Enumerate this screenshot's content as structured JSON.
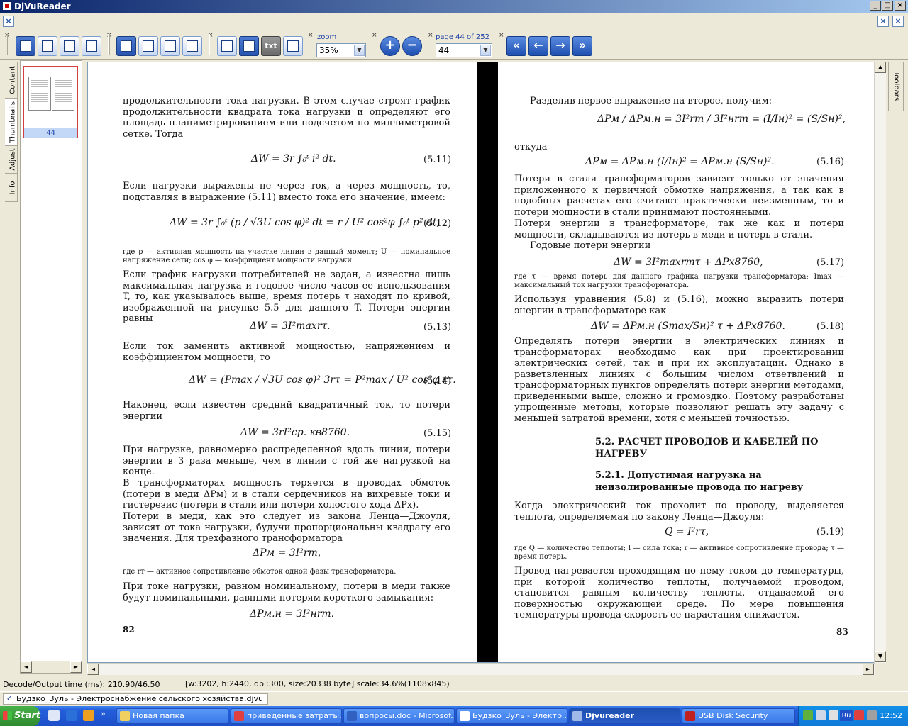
{
  "app": {
    "title": "DjVuReader"
  },
  "toolbar": {
    "zoom_label": "zoom",
    "zoom_value": "35%",
    "page_label": "page 44 of 252",
    "page_value": "44",
    "txt_label": "txt"
  },
  "sidebar": {
    "tabs": [
      {
        "label": "Content"
      },
      {
        "label": "Thumbnails"
      },
      {
        "label": "Adjust"
      },
      {
        "label": "Info"
      }
    ],
    "thumbnail_label": "44"
  },
  "right_tab": {
    "label": "Toolbars"
  },
  "document": {
    "left": {
      "p1": "продолжительности тока нагрузки. В этом случае строят график продолжительности квадрата тока нагрузки и определяют его площадь планиметрированием или подсчетом по миллиметровой сетке. Тогда",
      "f511": "ΔW = 3r ∫₀ᵗ i² dt.",
      "e511": "(5.11)",
      "p2": "Если нагрузки выражены не через ток, а через мощность, то, подставляя в выражение (5.11) вместо тока его значение, имеем:",
      "f512": "ΔW = 3r ∫₀ᵗ (p / √3U cos φ)² dt = r / U² cos²φ ∫₀ᵗ p² dt,",
      "e512": "(5.12)",
      "n512": "где p — активная мощность на участке линии в данный момент; U — номинальное напряжение сети; cos φ — коэффициент мощности нагрузки.",
      "p3": "Если график нагрузки потребителей не задан, а известна лишь максимальная нагрузка и годовое число часов ее использования T, то, как указывалось выше, время потерь τ находят по кривой, изображенной на рисунке 5.5 для данного T. Потери энергии равны",
      "f513": "ΔW = 3I²maxrτ.",
      "e513": "(5.13)",
      "p4": "Если ток заменить активной мощностью, напряжением и коэффициентом мощности, то",
      "f514": "ΔW = (Pmax / √3U cos φ)² 3rτ = P²max / U² cos²φ rτ.",
      "e514": "(5.14)",
      "p5": "Наконец, если известен средний квадратичный ток, то потери энергии",
      "f515": "ΔW = 3rI²ср. кв8760.",
      "e515": "(5.15)",
      "p6": "При нагрузке, равномерно распределенной вдоль линии, потери энергии в 3 раза меньше, чем в линии с той же нагрузкой на конце.",
      "p7": "В трансформаторах мощность теряется в проводах обмоток (потери в меди ΔPм) и в стали сердечников на вихревые токи и гистерезис (потери в стали или потери холостого хода ΔPx).",
      "p8": "Потери в меди, как это следует из закона Ленца—Джоуля, зависят от тока нагрузки, будучи пропорциональны квадрату его значения. Для трехфазного трансформатора",
      "f_cu": "ΔPм = 3I²rт,",
      "n_rt": "где rт — активное сопротивление обмоток одной фазы трансформатора.",
      "p9": "При токе нагрузки, равном номинальному, потери в меди также будут номинальными, равными потерям короткого замыкания:",
      "f_cun": "ΔPм.н = 3I²нrт.",
      "page_number": "82"
    },
    "right": {
      "p1": "Разделив первое выражение на второе, получим:",
      "f_ratio": "ΔPм / ΔPм.н = 3I²rт / 3I²нrт = (I/Iн)² = (S/Sн)²,",
      "otkuda": "откуда",
      "f516": "ΔPм = ΔPм.н (I/Iн)² = ΔPм.н (S/Sн)².",
      "e516": "(5.16)",
      "p2": "Потери в стали трансформаторов зависят только от значения приложенного к первичной обмотке напряжения, а так как в подобных расчетах его считают практически неизменным, то и потери мощности в стали принимают постоянными.",
      "p3": "Потери энергии в трансформаторе, так же как и потери мощности, складываются из потерь в меди и потерь в стали.",
      "p4": "Годовые потери энергии",
      "f517": "ΔW = 3I²maxrтτ + ΔPх8760,",
      "e517": "(5.17)",
      "n517": "где τ — время потерь для данного графика нагрузки трансформатора; Imax — максимальный ток нагрузки трансформатора.",
      "p5": "Используя уравнения (5.8) и (5.16), можно выразить потери энергии в трансформаторе как",
      "f518": "ΔW = ΔPм.н (Smax/Sн)² τ + ΔPх8760.",
      "e518": "(5.18)",
      "p6": "Определять потери энергии в электрических линиях и трансформаторах необходимо как при проектировании электрических сетей, так и при их эксплуатации. Однако в разветвленных линиях с большим числом ответвлений и трансформаторных пунктов определять потери энергии методами, приведенными выше, сложно и громоздко. Поэтому разработаны упрощенные методы, которые позволяют решать эту задачу с меньшей затратой времени, хотя с меньшей точностью.",
      "h1": "5.2. РАСЧЕТ ПРОВОДОВ И КАБЕЛЕЙ ПО НАГРЕВУ",
      "h2": "5.2.1. Допустимая нагрузка на неизолированные провода по нагреву",
      "p7": "Когда электрический ток проходит по проводу, выделяется теплота, определяемая по закону Ленца—Джоуля:",
      "f519": "Q = I²rτ,",
      "e519": "(5.19)",
      "n519": "где Q — количество теплоты; I — сила тока; r — активное сопротивление провода; τ — время потерь.",
      "p8": "Провод нагревается проходящим по нему током до температуры, при которой количество теплоты, получаемой проводом, становится равным количеству теплоты, отдаваемой его поверхностью окружающей среде. По мере повышения температуры провода скорость ее нарастания снижается.",
      "page_number": "83"
    }
  },
  "status": {
    "decode_time": "Decode/Output time (ms): 210.90/46.50",
    "info": "[w:3202, h:2440, dpi:300, size:20338 byte] scale:34.6%(1108x845)"
  },
  "mdi_caption": "Будзко_Зуль - Электроснабжение сельского хозяйства.djvu",
  "taskbar": {
    "start": "Start",
    "items": [
      {
        "label": "Новая папка"
      },
      {
        "label": "приведенные затраты..."
      },
      {
        "label": "вопросы.doc - Microsof..."
      },
      {
        "label": "Будзко_Зуль - Электр..."
      },
      {
        "label": "Djvureader"
      },
      {
        "label": "USB Disk Security"
      }
    ],
    "lang": "Ru",
    "clock": "12:52"
  },
  "colors": {
    "accent": "#245edb",
    "title_start": "#0a246a",
    "title_end": "#a6caf0"
  }
}
